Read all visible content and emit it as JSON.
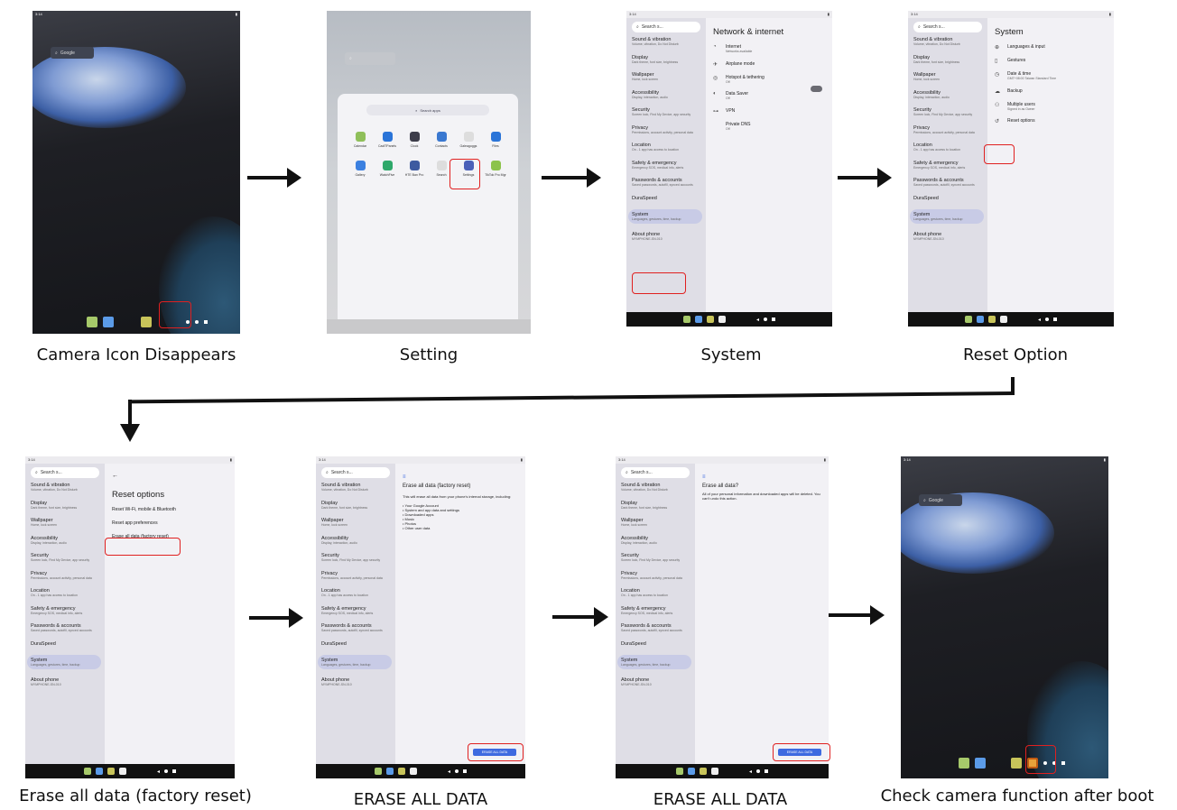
{
  "captions": [
    "Camera Icon Disappears",
    "Setting",
    "System",
    "Reset Option",
    "Erase all data (factory reset)",
    "ERASE ALL DATA",
    "ERASE ALL DATA",
    "Check camera function after boot"
  ],
  "home": {
    "search_label": "Google"
  },
  "drawer": {
    "search_placeholder": "Search apps",
    "apps": [
      {
        "label": "Calendar",
        "color": "#8fbf5a"
      },
      {
        "label": "CadiTPanels",
        "color": "#2a74d8"
      },
      {
        "label": "Clock",
        "color": "#3d3d4a"
      },
      {
        "label": "Contacts",
        "color": "#3a78d0"
      },
      {
        "label": "Galeagoggs",
        "color": "#ddd"
      },
      {
        "label": "Files",
        "color": "#2a74d8"
      },
      {
        "label": "Gallery",
        "color": "#3b80e0"
      },
      {
        "label": "WatchFive",
        "color": "#2fa86a"
      },
      {
        "label": "HTE Ban Pro",
        "color": "#3d5aa0"
      },
      {
        "label": "Search",
        "color": "#ddd"
      },
      {
        "label": "Settings",
        "color": "#4a60b8"
      },
      {
        "label": "TikTok Pro Mgr",
        "color": "#8cc34b"
      }
    ]
  },
  "settings": {
    "search": "Search s...",
    "items": [
      {
        "title": "Sound & vibration",
        "sub": "Volume, vibration, Do Not Disturb"
      },
      {
        "title": "Display",
        "sub": "Dark theme, font size, brightness"
      },
      {
        "title": "Wallpaper",
        "sub": "Home, lock screen"
      },
      {
        "title": "Accessibility",
        "sub": "Display, interaction, audio"
      },
      {
        "title": "Security",
        "sub": "Screen lock, Find My Device, app security"
      },
      {
        "title": "Privacy",
        "sub": "Permissions, account activity, personal data"
      },
      {
        "title": "Location",
        "sub": "On - 1 app has access to location"
      },
      {
        "title": "Safety & emergency",
        "sub": "Emergency SOS, medical info, alerts"
      },
      {
        "title": "Passwords & accounts",
        "sub": "Saved passwords, autofill, synced accounts"
      },
      {
        "title": "DuraSpeed",
        "sub": ""
      },
      {
        "title": "System",
        "sub": "Languages, gestures, time, backup"
      },
      {
        "title": "About phone",
        "sub": "MYMPHONE-SN-010"
      }
    ]
  },
  "network": {
    "title": "Network & internet",
    "rows": [
      {
        "icon": "◔",
        "title": "Internet",
        "sub": "Networks available"
      },
      {
        "icon": "✈",
        "title": "Airplane mode",
        "sub": ""
      },
      {
        "icon": "◎",
        "title": "Hotspot & tethering",
        "sub": "Off"
      },
      {
        "icon": "◐",
        "title": "Data Saver",
        "sub": "Off"
      },
      {
        "icon": "⊶",
        "title": "VPN",
        "sub": ""
      },
      {
        "icon": "",
        "title": "Private DNS",
        "sub": "Off"
      }
    ]
  },
  "system": {
    "title": "System",
    "rows": [
      {
        "icon": "⊕",
        "title": "Languages & input",
        "sub": ""
      },
      {
        "icon": "▯",
        "title": "Gestures",
        "sub": ""
      },
      {
        "icon": "◷",
        "title": "Date & time",
        "sub": "GMT+08:00 Taiwan Standard Time"
      },
      {
        "icon": "☁",
        "title": "Backup",
        "sub": ""
      },
      {
        "icon": "⚇",
        "title": "Multiple users",
        "sub": "Signed in as Owner"
      },
      {
        "icon": "↺",
        "title": "Reset options",
        "sub": ""
      }
    ]
  },
  "reset": {
    "back": "←",
    "title": "Reset options",
    "rows": [
      "Reset Wi-Fi, mobile & Bluetooth",
      "Reset app preferences",
      "Erase all data (factory reset)"
    ]
  },
  "erase1": {
    "title": "Erase all data (factory reset)",
    "intro": "This will erase all data from your phone's internal storage, including:",
    "bullets": [
      "• Your Google Account",
      "• System and app data and settings",
      "• Downloaded apps",
      "• Music",
      "• Photos",
      "• Other user data"
    ],
    "button": "ERASE ALL DATA"
  },
  "erase2": {
    "title": "Erase all data?",
    "body": "All of your personal information and downloaded apps will be deleted. You can't undo this action.",
    "button": "ERASE ALL DATA"
  },
  "status_time": "3:14",
  "colors": {
    "highlight": "#e02020",
    "accent": "#3d6ae0"
  }
}
